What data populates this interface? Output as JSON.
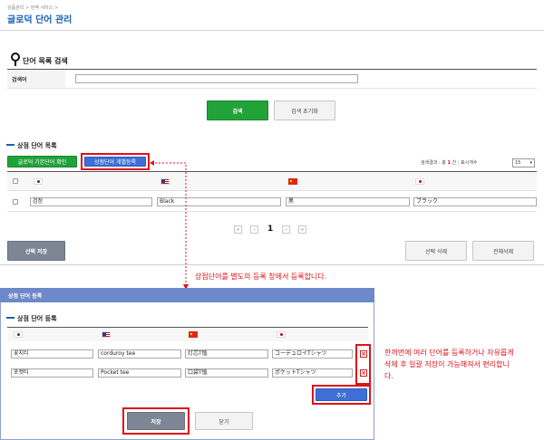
{
  "breadcrumb": "상품관리 > 번역 서비스 >",
  "page_title": "글로덕 단어 관리",
  "search": {
    "section_title": "단어 목록 검색",
    "field_label": "검색어",
    "input_value": "",
    "search_button": "검색",
    "reset_button": "검색 초기화"
  },
  "word_list": {
    "section_title": "상점 단어 목록",
    "btn_check_default": "글로덕 기본단어 확인",
    "btn_register_individual": "상점단어 개별등록",
    "result_prefix": "검색결과 : 총",
    "result_count": "1",
    "result_suffix": "건",
    "per_page_label": "표시개수",
    "per_page_value": "15",
    "flags": [
      "kr",
      "us",
      "cn",
      "jp"
    ],
    "rows": [
      {
        "ko": "검정",
        "en": "Black",
        "zh": "黑",
        "ja": "ブラック"
      }
    ],
    "pagination": {
      "first": "«",
      "prev": "‹",
      "current": "1",
      "next": "›",
      "last": "»"
    },
    "btn_save_selected": "선택 저장",
    "btn_delete_selected": "선택 삭제",
    "btn_delete_all": "전체삭제"
  },
  "annotation_1": "상점단어를 별도의 등록 창에서 등록합니다.",
  "popup": {
    "header": "상점 단어 등록",
    "section_title": "상점 단어 등록",
    "rows": [
      {
        "ko": "꽃지티",
        "en": "corduroy tee",
        "zh": "灯芯T恤",
        "ja": "コーデュロイTシャツ"
      },
      {
        "ko": "포켓티",
        "en": "Pocket tee",
        "zh": "口袋T恤",
        "ja": "ポケットTシャツ"
      }
    ],
    "delete_symbol": "×",
    "btn_add": "추가",
    "btn_save": "저장",
    "btn_close": "닫기"
  },
  "annotation_2": "한꺼번에 여러 단어를 등록하거나 자유롭게 삭제 후 일괄 저장이 가능해져서 편리합니다.",
  "colors": {
    "accent_red": "#e0101a",
    "green": "#22a33a",
    "blue": "#3d6fd6",
    "popup_header": "#6d89c9",
    "title_blue": "#1c5fb8"
  }
}
